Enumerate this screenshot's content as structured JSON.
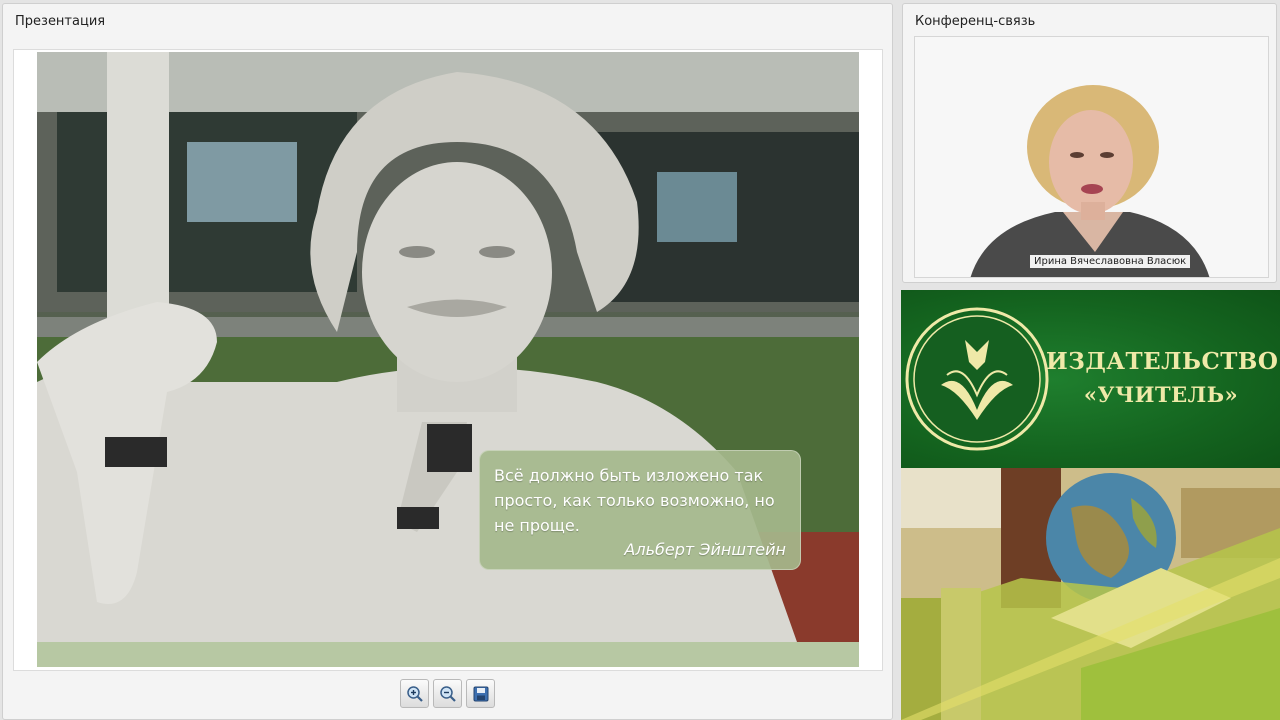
{
  "presentation": {
    "title": "Презентация",
    "quote": {
      "text": "Всё должно быть изложено так просто, как только возможно, но не проще.",
      "author": "Альберт Эйнштейн"
    },
    "toolbar": {
      "zoom_in_icon": "zoom-in-icon",
      "zoom_out_icon": "zoom-out-icon",
      "save_icon": "save-icon"
    }
  },
  "conference": {
    "title": "Конференц-связь",
    "speaker_name": "Ирина Вячеславовна Власюк"
  },
  "banner": {
    "line1": "ИЗДАТЕЛЬСТВО",
    "line2": "«УЧИТЕЛЬ»",
    "colors": {
      "background": "#14641f",
      "text": "#efe9a8"
    }
  }
}
